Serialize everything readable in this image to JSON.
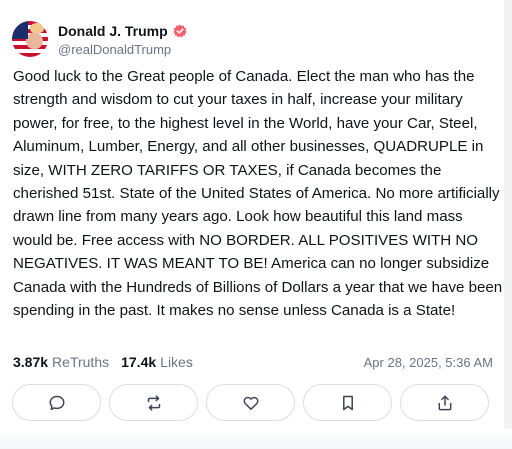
{
  "author": {
    "display_name": "Donald J. Trump",
    "handle": "@realDonaldTrump",
    "avatar_icon": "avatar-flag-portrait",
    "verified_icon": "verified-badge-icon",
    "verified_color": "#f4606c"
  },
  "post": {
    "text": "Good luck to the Great people of Canada. Elect the man who has the strength and wisdom to cut your taxes in half, increase your military power, for free, to the highest level in the World, have your Car, Steel, Aluminum, Lumber, Energy, and all other businesses, QUADRUPLE in size, WITH ZERO TARIFFS OR TAXES, if Canada becomes the cherished 51st. State of the United States of America. No more artificially drawn line from many years ago. Look how beautiful this land mass would be. Free access with NO BORDER. ALL POSITIVES WITH NO NEGATIVES. IT WAS MEANT TO BE! America can no longer subsidize Canada with the Hundreds of Billions of Dollars a year that we have been spending in the past. It makes no sense unless Canada is a State!"
  },
  "stats": {
    "retruths_count": "3.87k",
    "retruths_label": "ReTruths",
    "likes_count": "17.4k",
    "likes_label": "Likes",
    "timestamp": "Apr 28, 2025, 5:36 AM"
  },
  "actions": [
    {
      "name": "reply",
      "icon": "comment-bubble-icon"
    },
    {
      "name": "retruth",
      "icon": "repost-arrows-icon"
    },
    {
      "name": "like",
      "icon": "heart-icon"
    },
    {
      "name": "bookmark",
      "icon": "bookmark-icon"
    },
    {
      "name": "share",
      "icon": "share-upload-icon"
    }
  ],
  "colors": {
    "text": "#0f1419",
    "muted": "#687585",
    "border": "#d9dde3"
  }
}
